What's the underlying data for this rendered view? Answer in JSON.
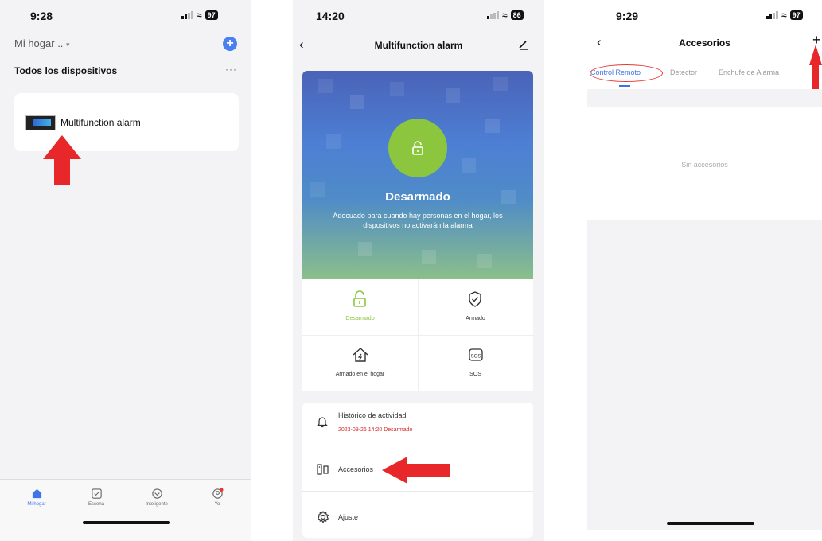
{
  "screen1": {
    "time": "9:28",
    "battery": "97",
    "home_selector": "Mi hogar ..",
    "section_title": "Todos los dispositivos",
    "more_label": "···",
    "device_name": "Multifunction alarm",
    "tabs": [
      {
        "label": "Mi hogar",
        "icon": "home-icon",
        "active": true
      },
      {
        "label": "Escena",
        "icon": "scene-icon",
        "active": false
      },
      {
        "label": "Inteligente",
        "icon": "smart-icon",
        "active": false
      },
      {
        "label": "Yo",
        "icon": "profile-icon",
        "active": false
      }
    ]
  },
  "screen2": {
    "time": "14:20",
    "battery": "86",
    "title": "Multifunction alarm",
    "state_title": "Desarmado",
    "state_description": "Adecuado para cuando hay personas en el hogar, los dispositivos no activarán la alarma",
    "modes": [
      {
        "label": "Desarmado",
        "icon": "unlock-icon",
        "active": true
      },
      {
        "label": "Armado",
        "icon": "shield-check-icon",
        "active": false
      },
      {
        "label": "Armado en el hogar",
        "icon": "home-shield-icon",
        "active": false
      },
      {
        "label": "SOS",
        "icon": "sos-icon",
        "active": false
      }
    ],
    "history_label": "Histórico de actividad",
    "history_sub": "2023-09-26 14:20 Desarmado",
    "accessories_label": "Accesorios",
    "settings_label": "Ajuste"
  },
  "screen3": {
    "time": "9:29",
    "battery": "97",
    "title": "Accesorios",
    "tabs": [
      "Control Remoto",
      "Detector",
      "Enchufe de Alarma"
    ],
    "selected_tab": "Control Remoto",
    "empty_text": "Sin accesorios"
  },
  "colors": {
    "accent_blue": "#3f74e8",
    "green": "#8cc63f",
    "red_annotation": "#e53935"
  }
}
